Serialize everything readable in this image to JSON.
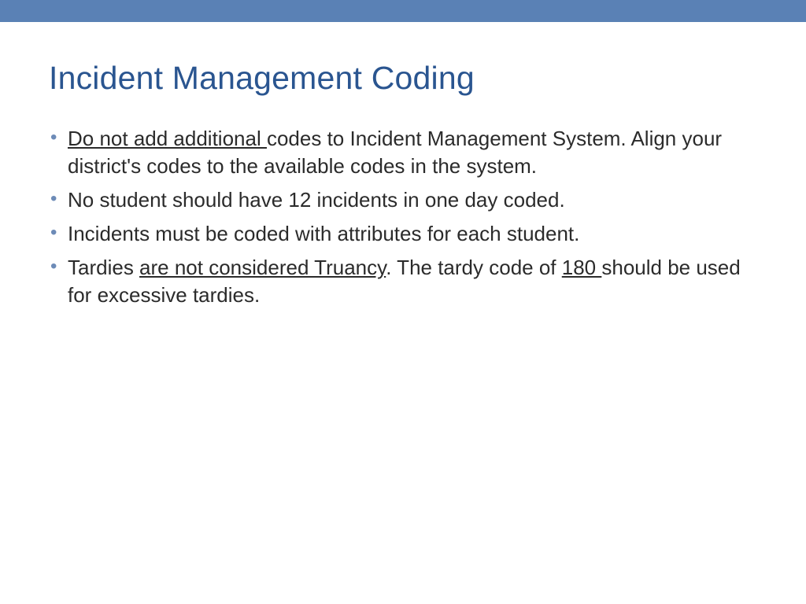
{
  "slide": {
    "title": "Incident Management Coding",
    "bullets": [
      {
        "segments": [
          {
            "text": "Do not add additional ",
            "underline": true
          },
          {
            "text": "codes to Incident Management System. Align your district's codes to the available codes in the system.",
            "underline": false
          }
        ]
      },
      {
        "segments": [
          {
            "text": "No student should have 12 incidents in one day coded.",
            "underline": false
          }
        ]
      },
      {
        "segments": [
          {
            "text": "Incidents must be coded with attributes for each student.",
            "underline": false
          }
        ]
      },
      {
        "segments": [
          {
            "text": "Tardies ",
            "underline": false
          },
          {
            "text": "are not considered Truancy",
            "underline": true
          },
          {
            "text": ". The tardy code of ",
            "underline": false
          },
          {
            "text": "180 ",
            "underline": true
          },
          {
            "text": "should be used for excessive tardies.",
            "underline": false
          }
        ]
      }
    ]
  }
}
